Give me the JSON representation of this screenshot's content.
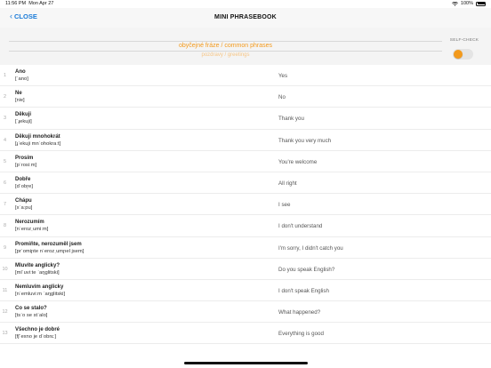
{
  "status": {
    "time": "11:56 PM",
    "date": "Mon Apr 27",
    "battery": "100%"
  },
  "nav": {
    "close_label": "CLOSE",
    "title": "MINI PHRASEBOOK"
  },
  "header": {
    "category_title": "obyčejné fráze / common phrases",
    "category_subtitle": "pozdravy / greetings",
    "selfcheck_label": "SELF-CHECK",
    "selfcheck_on": true,
    "accent_color": "#f39a1c"
  },
  "phrases": [
    {
      "num": "1",
      "czech": "Ano",
      "pron": "[ˈano]",
      "english": "Yes"
    },
    {
      "num": "2",
      "czech": "Ne",
      "pron": "[nʲe]",
      "english": "No"
    },
    {
      "num": "3",
      "czech": "Děkuji",
      "pron": "[ˈɟekuji]",
      "english": "Thank you"
    },
    {
      "num": "4",
      "czech": "Děkuji mnohokrát",
      "pron": "[ɟˈekuji mnˈohokraːt]",
      "english": "Thank you very much"
    },
    {
      "num": "5",
      "czech": "Prosím",
      "pron": "[pˈrosiːm]",
      "english": "You're welcome"
    },
    {
      "num": "6",
      "czech": "Dobře",
      "pron": "[dˈobr̝e]",
      "english": "All right"
    },
    {
      "num": "7",
      "czech": "Chápu",
      "pron": "[xˈaːpu]",
      "english": "I see"
    },
    {
      "num": "8",
      "czech": "Nerozumím",
      "pron": "[nˈerozˌumiːm]",
      "english": "I don't understand"
    },
    {
      "num": "9",
      "czech": "Promiňte, nerozuměl jsem",
      "pron": "[prˈomiɲte nˈerozˌumɲel jsem]",
      "english": "I'm sorry, I didn't catch you"
    },
    {
      "num": "10",
      "czech": "Mluvíte anglicky?",
      "pron": "[mlˈuviːte ˈaŋglitski]",
      "english": "Do you speak English?"
    },
    {
      "num": "11",
      "czech": "Nemluvím anglicky",
      "pron": "[nˈemluviːm ˈaŋglitski]",
      "english": "I don't speak English"
    },
    {
      "num": "12",
      "czech": "Co se stalo?",
      "pron": "[tsˈo se stˈalo]",
      "english": "What happened?"
    },
    {
      "num": "13",
      "czech": "Všechno je dobré",
      "pron": "[fʃˈexno je dˈobrɛː]",
      "english": "Everything is good"
    }
  ]
}
